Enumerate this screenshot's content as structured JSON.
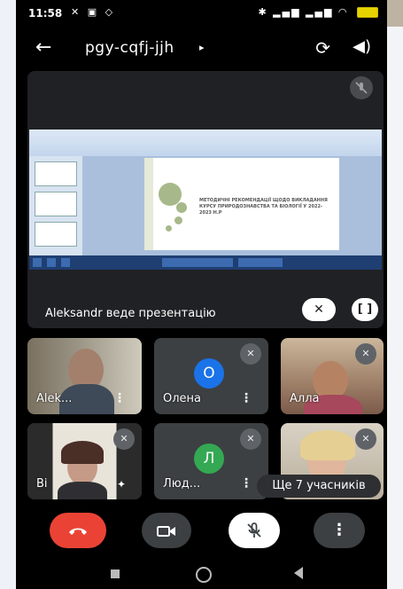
{
  "status_bar": {
    "time": "11:58",
    "left_icons": "✕ ▣ ◇",
    "right_icons": "✱ ▂▄▆ ▂▄▆ ◠"
  },
  "app_bar": {
    "meeting_code": "pgy-cqfj-jjh",
    "caret": "▸",
    "back_glyph": "←",
    "camera_switch_glyph": "⟳",
    "speaker_glyph": "◀)"
  },
  "presentation": {
    "presenting_text": "Aleksandr веде презентацію",
    "slide_title": "Методичні рекомендації щодо викладання курсу природознавства та біології у 2022-2023 н.р",
    "pin_glyph": "✕",
    "fullscreen_glyph": "[ ]"
  },
  "participants": [
    {
      "name": "Alek...",
      "type": "video"
    },
    {
      "name": "Олена",
      "type": "avatar",
      "initial": "О",
      "color": "#1a73e8"
    },
    {
      "name": "Алла",
      "type": "video"
    },
    {
      "name": "Ві",
      "type": "video"
    },
    {
      "name": "Люд...",
      "type": "avatar",
      "initial": "Л",
      "color": "#34a853"
    },
    {
      "name": "",
      "type": "video"
    }
  ],
  "more_participants": "Ще 7 учасників",
  "controls": {
    "end_call_glyph": "☎",
    "video_glyph": "▭",
    "mic_glyph": "✕",
    "more_glyph": "⋮"
  },
  "icons": {
    "mic_off": "✕",
    "more": "⋮"
  }
}
